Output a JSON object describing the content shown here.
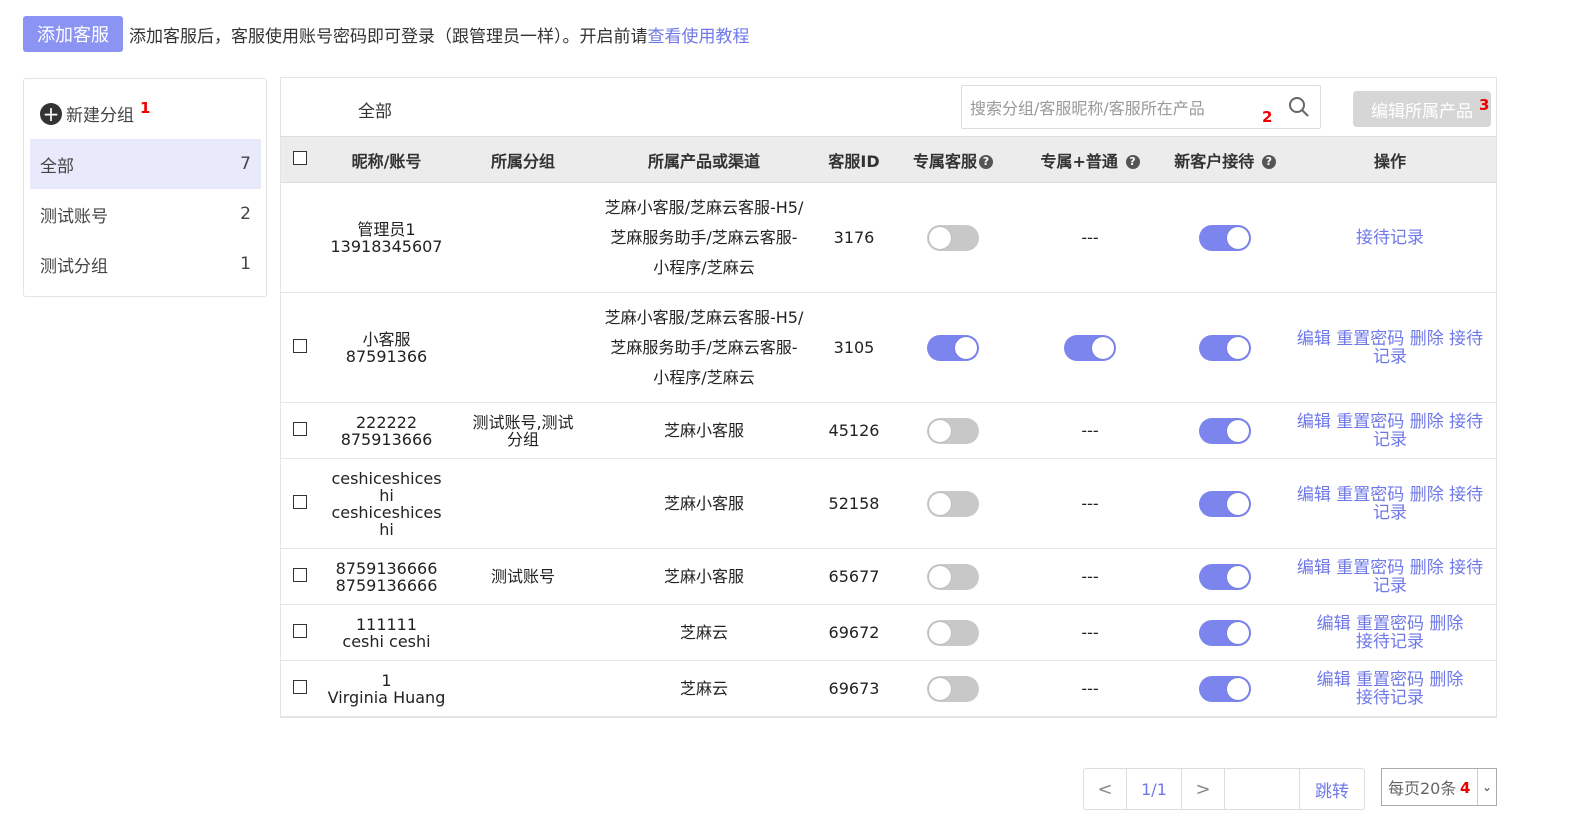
{
  "header": {
    "add_button": "添加客服",
    "intro_text": "添加客服后，客服使用账号密码即可登录（跟管理员一样）。开启前请",
    "intro_link": "查看使用教程"
  },
  "sidebar": {
    "new_group": "新建分组",
    "marker": "1",
    "groups": [
      {
        "name": "全部",
        "count": "7"
      },
      {
        "name": "测试账号",
        "count": "2"
      },
      {
        "name": "测试分组",
        "count": "1"
      }
    ]
  },
  "panel": {
    "title": "全部",
    "search_placeholder": "搜索分组/客服昵称/客服所在产品",
    "search_marker": "2",
    "edit_product_button": "编辑所属产品",
    "edit_marker": "3"
  },
  "table": {
    "headers": {
      "name": "昵称/账号",
      "group": "所属分组",
      "product": "所属产品或渠道",
      "id": "客服ID",
      "exclusive": "专属客服",
      "exclusive_normal": "专属+普通",
      "new_customer": "新客户接待",
      "actions": "操作"
    },
    "rows": [
      {
        "nick": "管理员1",
        "account": "13918345607",
        "group": "",
        "product": "芝麻小客服/芝麻云客服-H5/芝麻服务助手/芝麻云客服-小程序/芝麻云",
        "id": "3176",
        "exclusive": false,
        "exclusive_normal": "---",
        "new_customer": true,
        "actions": "接待记录"
      },
      {
        "nick": "小客服",
        "account": "87591366",
        "group": "",
        "product": "芝麻小客服/芝麻云客服-H5/芝麻服务助手/芝麻云客服-小程序/芝麻云",
        "id": "3105",
        "exclusive": true,
        "exclusive_normal": "on",
        "new_customer": true,
        "actions": "编辑 重置密码 删除 接待记录"
      },
      {
        "nick": "222222",
        "account": "875913666",
        "group": "测试账号,测试分组",
        "product": "芝麻小客服",
        "id": "45126",
        "exclusive": false,
        "exclusive_normal": "---",
        "new_customer": true,
        "actions": "编辑 重置密码 删除 接待记录"
      },
      {
        "nick": "ceshiceshices hi",
        "account": "ceshiceshices hi",
        "group": "",
        "product": "芝麻小客服",
        "id": "52158",
        "exclusive": false,
        "exclusive_normal": "---",
        "new_customer": true,
        "actions": "编辑 重置密码 删除 接待记录"
      },
      {
        "nick": "8759136666",
        "account": "8759136666",
        "group": "测试账号",
        "product": "芝麻小客服",
        "id": "65677",
        "exclusive": false,
        "exclusive_normal": "---",
        "new_customer": true,
        "actions": "编辑 重置密码 删除 接待记录"
      },
      {
        "nick": "111111",
        "account": "ceshi ceshi",
        "group": "",
        "product": "芝麻云",
        "id": "69672",
        "exclusive": false,
        "exclusive_normal": "---",
        "new_customer": true,
        "actions": "编辑 重置密码 删除 接待记录"
      },
      {
        "nick": "1",
        "account": "Virginia Huang",
        "group": "",
        "product": "芝麻云",
        "id": "69673",
        "exclusive": false,
        "exclusive_normal": "---",
        "new_customer": true,
        "actions": "编辑 重置密码 删除 接待记录"
      }
    ]
  },
  "pagination": {
    "prev": "<",
    "current": "1/1",
    "next": ">",
    "go": "跳转",
    "page_size": "每页20条",
    "marker": "4"
  },
  "colors": {
    "accent": "#8b93f3",
    "link": "#6f78e8",
    "toggle_on": "#7c84ee",
    "toggle_off": "#c8c8c8"
  }
}
